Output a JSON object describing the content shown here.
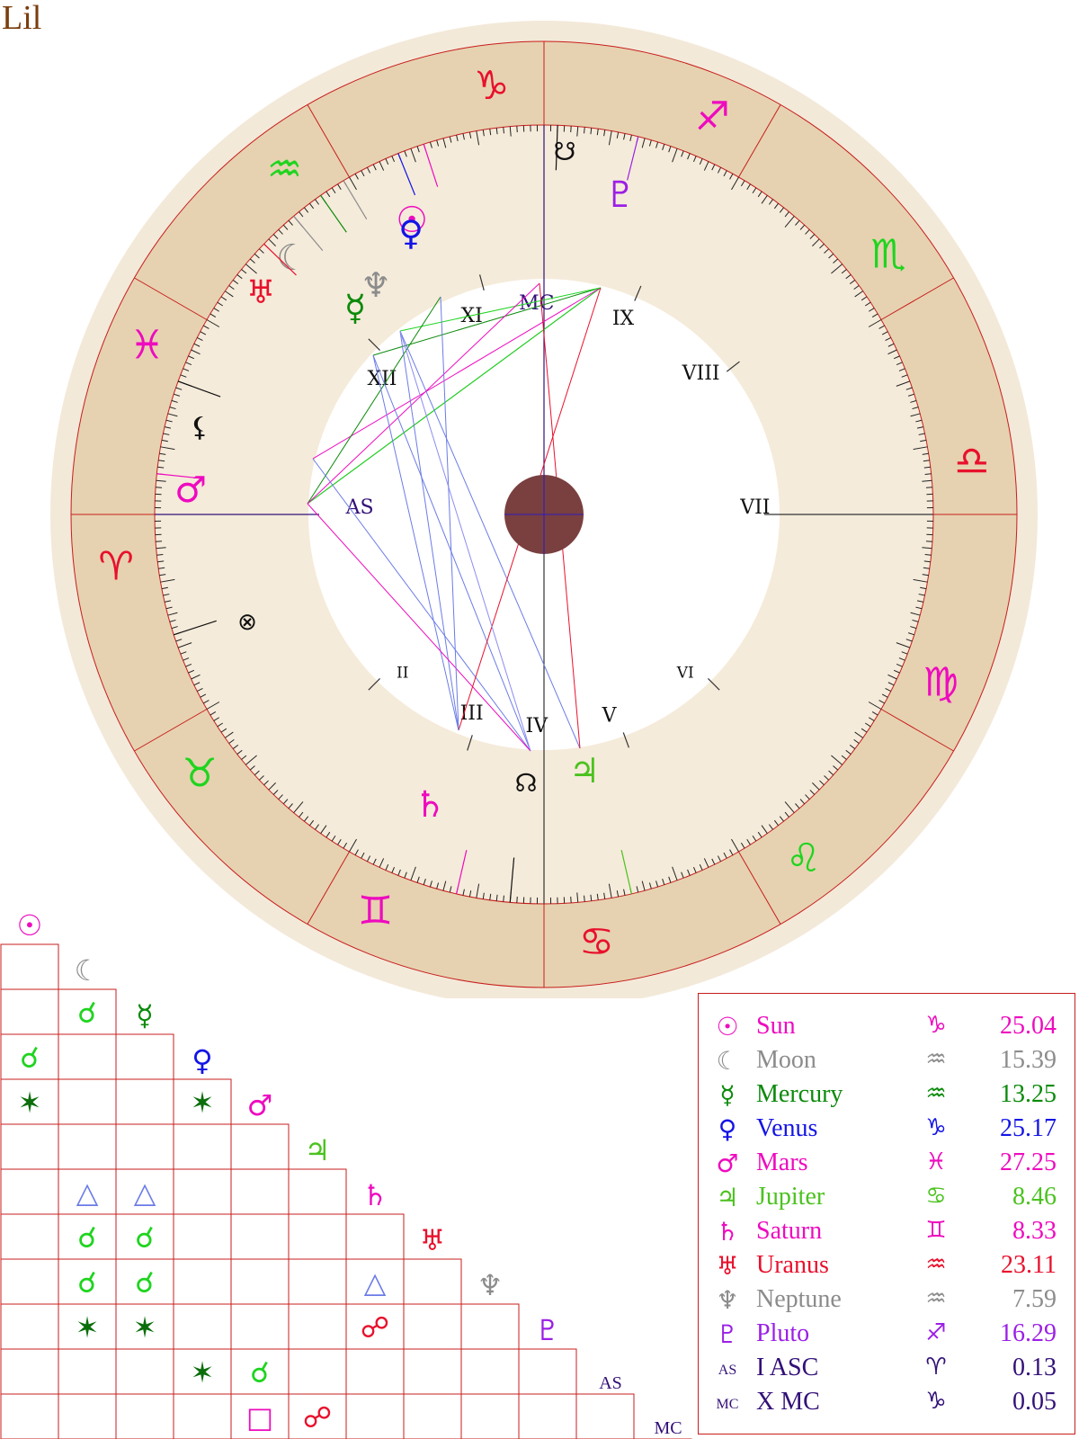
{
  "title": "Lil",
  "colors": {
    "outer_ring": "#f3e9d9",
    "zodiac_band": "#e6d2b0",
    "house_band": "#f5ebda",
    "center_disc": "#7a3f3f",
    "grid_line": "#c81d1d",
    "red": "#e8112d",
    "magenta": "#ee0bbf",
    "gray": "#8c8c8c",
    "green": "#0b8a0b",
    "blue": "#1414e6",
    "lime": "#1fd41f",
    "purple": "#6b1fd6",
    "violet": "#9b1fe6",
    "navy": "#321078"
  },
  "zodiac": [
    {
      "name": "capricorn",
      "glyph": "♑",
      "color": "#e8112d"
    },
    {
      "name": "aquarius",
      "glyph": "♒",
      "color": "#1fd41f"
    },
    {
      "name": "pisces",
      "glyph": "♓",
      "color": "#ee0bbf"
    },
    {
      "name": "aries",
      "glyph": "♈",
      "color": "#e8112d"
    },
    {
      "name": "taurus",
      "glyph": "♉",
      "color": "#1fd41f"
    },
    {
      "name": "gemini",
      "glyph": "♊",
      "color": "#ee0bbf"
    },
    {
      "name": "cancer",
      "glyph": "♋",
      "color": "#e8112d"
    },
    {
      "name": "leo",
      "glyph": "♌",
      "color": "#1fd41f"
    },
    {
      "name": "virgo",
      "glyph": "♍",
      "color": "#ee0bbf"
    },
    {
      "name": "libra",
      "glyph": "♎",
      "color": "#e8112d"
    },
    {
      "name": "scorpio",
      "glyph": "♏",
      "color": "#1fd41f"
    },
    {
      "name": "sagittarius",
      "glyph": "♐",
      "color": "#ee0bbf"
    }
  ],
  "houses": {
    "numerals": [
      "AS",
      "II",
      "III",
      "IV",
      "V",
      "VI",
      "VII",
      "VIII",
      "IX",
      "MC",
      "XI",
      "XII"
    ]
  },
  "chart_points": [
    {
      "id": "sun",
      "glyph": "☉",
      "color": "#ee0bbf"
    },
    {
      "id": "moon",
      "glyph": "☾",
      "color": "#8c8c8c"
    },
    {
      "id": "mercury",
      "glyph": "☿",
      "color": "#0b8a0b"
    },
    {
      "id": "venus",
      "glyph": "♀",
      "color": "#1414e6"
    },
    {
      "id": "mars",
      "glyph": "♂",
      "color": "#ee0bbf"
    },
    {
      "id": "jupiter",
      "glyph": "♃",
      "color": "#4bc21f"
    },
    {
      "id": "saturn",
      "glyph": "♄",
      "color": "#ee0bbf"
    },
    {
      "id": "uranus",
      "glyph": "♅",
      "color": "#e8112d"
    },
    {
      "id": "neptune",
      "glyph": "♆",
      "color": "#8c8c8c"
    },
    {
      "id": "pluto",
      "glyph": "♇",
      "color": "#9b1fe6"
    },
    {
      "id": "north-node",
      "glyph": "☊",
      "color": "#111111"
    },
    {
      "id": "south-node",
      "glyph": "☋",
      "color": "#111111"
    },
    {
      "id": "lilith",
      "glyph": "⚸",
      "color": "#111111"
    },
    {
      "id": "fortune",
      "glyph": "⊗",
      "color": "#111111"
    }
  ],
  "aspect_grid": {
    "columns": [
      {
        "glyph": "☉",
        "color": "#ee0bbf"
      },
      {
        "glyph": "☾",
        "color": "#8c8c8c"
      },
      {
        "glyph": "☿",
        "color": "#0b8a0b"
      },
      {
        "glyph": "♀",
        "color": "#1414e6"
      },
      {
        "glyph": "♂",
        "color": "#ee0bbf"
      },
      {
        "glyph": "♃",
        "color": "#4bc21f"
      },
      {
        "glyph": "♄",
        "color": "#ee0bbf"
      },
      {
        "glyph": "♅",
        "color": "#e8112d"
      },
      {
        "glyph": "♆",
        "color": "#8c8c8c"
      },
      {
        "glyph": "♇",
        "color": "#9b1fe6"
      },
      {
        "glyph": "AS",
        "color": "#321078"
      },
      {
        "glyph": "MC",
        "color": "#321078"
      }
    ],
    "aspects": [
      {
        "row": 2,
        "col": 1,
        "glyph": "☌",
        "color": "#1fd41f"
      },
      {
        "row": 3,
        "col": 0,
        "glyph": "☌",
        "color": "#1fd41f"
      },
      {
        "row": 4,
        "col": 0,
        "glyph": "✶",
        "color": "#0b6e0b"
      },
      {
        "row": 4,
        "col": 3,
        "glyph": "✶",
        "color": "#0b6e0b"
      },
      {
        "row": 6,
        "col": 1,
        "glyph": "△",
        "color": "#6b7ce6"
      },
      {
        "row": 6,
        "col": 2,
        "glyph": "△",
        "color": "#6b7ce6"
      },
      {
        "row": 7,
        "col": 1,
        "glyph": "☌",
        "color": "#1fd41f"
      },
      {
        "row": 7,
        "col": 2,
        "glyph": "☌",
        "color": "#1fd41f"
      },
      {
        "row": 8,
        "col": 1,
        "glyph": "☌",
        "color": "#1fd41f"
      },
      {
        "row": 8,
        "col": 2,
        "glyph": "☌",
        "color": "#1fd41f"
      },
      {
        "row": 8,
        "col": 6,
        "glyph": "△",
        "color": "#6b7ce6"
      },
      {
        "row": 9,
        "col": 1,
        "glyph": "✶",
        "color": "#0b6e0b"
      },
      {
        "row": 9,
        "col": 2,
        "glyph": "✶",
        "color": "#0b6e0b"
      },
      {
        "row": 9,
        "col": 6,
        "glyph": "☍",
        "color": "#e8112d"
      },
      {
        "row": 10,
        "col": 3,
        "glyph": "✶",
        "color": "#0b6e0b"
      },
      {
        "row": 10,
        "col": 4,
        "glyph": "☌",
        "color": "#1fd41f"
      },
      {
        "row": 11,
        "col": 4,
        "glyph": "□",
        "color": "#ee0bbf"
      },
      {
        "row": 11,
        "col": 5,
        "glyph": "☍",
        "color": "#e8112d"
      }
    ]
  },
  "legend": [
    {
      "glyph": "☉",
      "name": "Sun",
      "sign": "♑",
      "deg": "25.04",
      "color": "#ee0bbf"
    },
    {
      "glyph": "☾",
      "name": "Moon",
      "sign": "♒",
      "deg": "15.39",
      "color": "#8c8c8c"
    },
    {
      "glyph": "☿",
      "name": "Mercury",
      "sign": "♒",
      "deg": "13.25",
      "color": "#0b8a0b"
    },
    {
      "glyph": "♀",
      "name": "Venus",
      "sign": "♑",
      "deg": "25.17",
      "color": "#1414e6"
    },
    {
      "glyph": "♂",
      "name": "Mars",
      "sign": "♓",
      "deg": "27.25",
      "color": "#ee0bbf"
    },
    {
      "glyph": "♃",
      "name": "Jupiter",
      "sign": "♋",
      "deg": "8.46",
      "color": "#4bc21f"
    },
    {
      "glyph": "♄",
      "name": "Saturn",
      "sign": "♊",
      "deg": "8.33",
      "color": "#ee0bbf"
    },
    {
      "glyph": "♅",
      "name": "Uranus",
      "sign": "♒",
      "deg": "23.11",
      "color": "#e8112d"
    },
    {
      "glyph": "♆",
      "name": "Neptune",
      "sign": "♒",
      "deg": "7.59",
      "color": "#8c8c8c"
    },
    {
      "glyph": "♇",
      "name": "Pluto",
      "sign": "♐",
      "deg": "16.29",
      "color": "#9b1fe6"
    },
    {
      "glyph": "AS",
      "name": "I ASC",
      "sign": "♈",
      "deg": "0.13",
      "color": "#321078",
      "abbr": true
    },
    {
      "glyph": "MC",
      "name": "X MC",
      "sign": "♑",
      "deg": "0.05",
      "color": "#321078",
      "abbr": true
    }
  ]
}
